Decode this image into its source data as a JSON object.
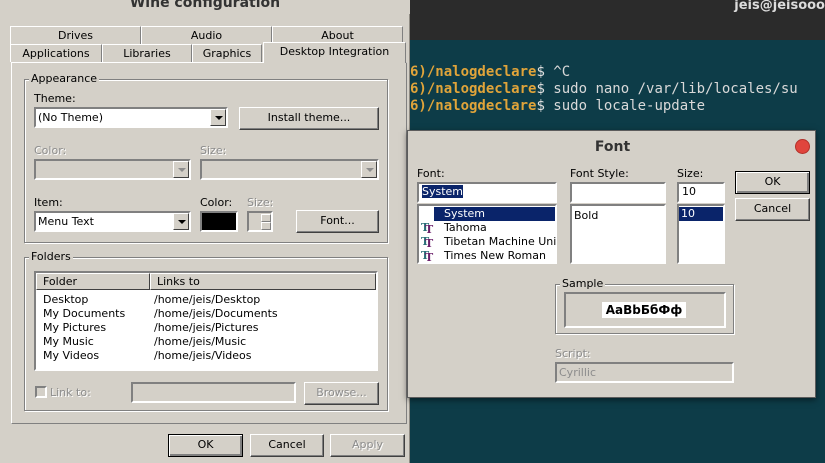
{
  "terminal": {
    "title": "jeis@jeisooo",
    "lines": [
      {
        "path": "6)/nalogdeclare",
        "prompt": "$",
        "cmd": " ^C"
      },
      {
        "path": "6)/nalogdeclare",
        "prompt": "$",
        "cmd": " sudo nano /var/lib/locales/su"
      },
      {
        "path": "6)/nalogdeclare",
        "prompt": "$",
        "cmd": " sudo locale-update"
      }
    ]
  },
  "wine": {
    "title": "Wine configuration",
    "tabs_row1": [
      "Drives",
      "Audio",
      "About"
    ],
    "tabs_row2": [
      "Applications",
      "Libraries",
      "Graphics",
      "Desktop Integration"
    ],
    "appearance": {
      "group_title": "Appearance",
      "theme_label": "Theme:",
      "theme_value": "(No Theme)",
      "install_theme_label": "Install theme...",
      "color_label": "Color:",
      "size_label": "Size:",
      "item_label": "Item:",
      "item_value": "Menu Text",
      "item_color_label": "Color:",
      "item_size_label": "Size:",
      "font_button_label": "Font...",
      "item_color_value": "#000000"
    },
    "folders": {
      "group_title": "Folders",
      "columns": [
        "Folder",
        "Links to"
      ],
      "rows": [
        [
          "Desktop",
          "/home/jeis/Desktop"
        ],
        [
          "My Documents",
          "/home/jeis/Documents"
        ],
        [
          "My Pictures",
          "/home/jeis/Pictures"
        ],
        [
          "My Music",
          "/home/jeis/Music"
        ],
        [
          "My Videos",
          "/home/jeis/Videos"
        ]
      ],
      "link_to_label": "Link to:",
      "browse_label": "Browse..."
    },
    "buttons": {
      "ok": "OK",
      "cancel": "Cancel",
      "apply": "Apply"
    }
  },
  "font_dialog": {
    "title": "Font",
    "font_label": "Font:",
    "font_value": "System",
    "fonts": [
      "System",
      "Tahoma",
      "Tibetan Machine Uni",
      "Times New Roman"
    ],
    "style_label": "Font Style:",
    "style_value": "",
    "styles": [
      "Bold"
    ],
    "size_label": "Size:",
    "size_value": "10",
    "sizes": [
      "10"
    ],
    "ok_label": "OK",
    "cancel_label": "Cancel",
    "sample_label": "Sample",
    "sample_text": "AaBbБбФф",
    "script_label": "Script:",
    "script_value": "Cyrillic",
    "selection_color": "#0a246a"
  }
}
